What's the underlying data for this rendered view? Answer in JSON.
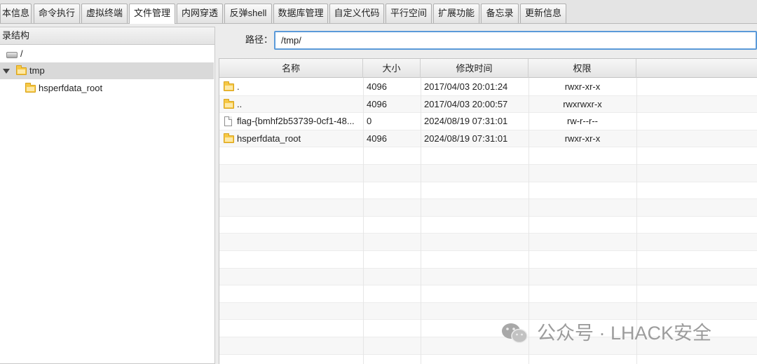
{
  "tabs": [
    {
      "label": "本信息"
    },
    {
      "label": "命令执行"
    },
    {
      "label": "虚拟终端"
    },
    {
      "label": "文件管理",
      "active": true
    },
    {
      "label": "内网穿透"
    },
    {
      "label": "反弹shell"
    },
    {
      "label": "数据库管理"
    },
    {
      "label": "自定义代码"
    },
    {
      "label": "平行空间"
    },
    {
      "label": "扩展功能"
    },
    {
      "label": "备忘录"
    },
    {
      "label": "更新信息"
    }
  ],
  "tree": {
    "header": "录结构",
    "items": [
      {
        "label": "/",
        "icon": "drive-icon"
      },
      {
        "label": "tmp",
        "icon": "folder-icon",
        "expanded": true,
        "selected": true
      },
      {
        "label": "hsperfdata_root",
        "icon": "folder-icon"
      }
    ]
  },
  "path": {
    "label": "路径：",
    "value": "/tmp/"
  },
  "table": {
    "columns": [
      "名称",
      "大小",
      "修改时间",
      "权限"
    ],
    "rows": [
      {
        "name": ".",
        "type": "folder",
        "size": "4096",
        "mtime": "2017/04/03 20:01:24",
        "perm": "rwxr-xr-x"
      },
      {
        "name": "..",
        "type": "folder",
        "size": "4096",
        "mtime": "2017/04/03 20:00:57",
        "perm": "rwxrwxr-x"
      },
      {
        "name": "flag-{bmhf2b53739-0cf1-48...",
        "type": "file",
        "size": "0",
        "mtime": "2024/08/19 07:31:01",
        "perm": "rw-r--r--"
      },
      {
        "name": "hsperfdata_root",
        "type": "folder",
        "size": "4096",
        "mtime": "2024/08/19 07:31:01",
        "perm": "rwxr-xr-x"
      }
    ]
  },
  "watermark": {
    "text": "公众号 · LHACK安全"
  }
}
